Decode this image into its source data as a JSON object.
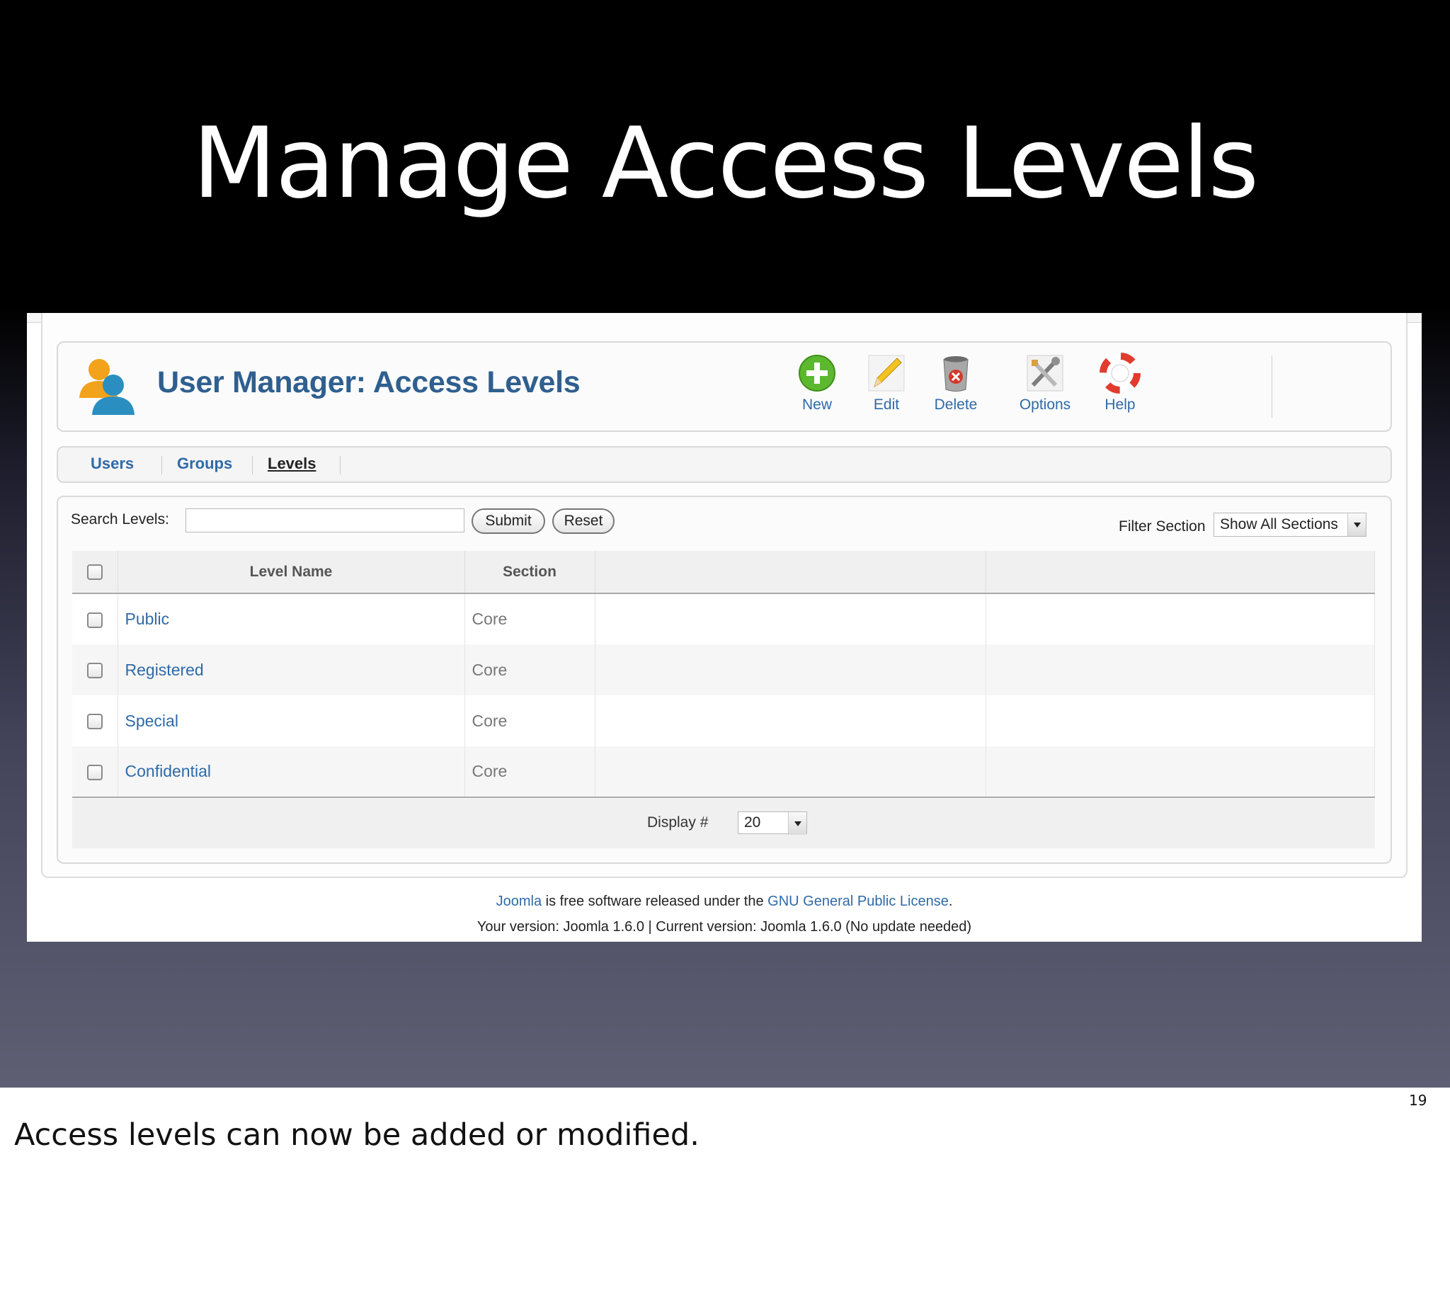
{
  "slide": {
    "title": "Manage Access Levels",
    "number": "19",
    "note": "Access levels can now be added or modified."
  },
  "header": {
    "title": "User Manager: Access Levels"
  },
  "toolbar": {
    "new_label": "New",
    "edit_label": "Edit",
    "delete_label": "Delete",
    "options_label": "Options",
    "help_label": "Help"
  },
  "submenu": {
    "tabs": [
      {
        "label": "Users",
        "active": false
      },
      {
        "label": "Groups",
        "active": false
      },
      {
        "label": "Levels",
        "active": true
      }
    ]
  },
  "filters": {
    "search_label": "Search Levels:",
    "search_value": "",
    "submit_label": "Submit",
    "reset_label": "Reset",
    "filter_label": "Filter Section",
    "filter_selected": "Show All Sections"
  },
  "table": {
    "columns": [
      "Level Name",
      "Section"
    ],
    "rows": [
      {
        "name": "Public",
        "section": "Core"
      },
      {
        "name": "Registered",
        "section": "Core"
      },
      {
        "name": "Special",
        "section": "Core"
      },
      {
        "name": "Confidential",
        "section": "Core"
      }
    ]
  },
  "pagination": {
    "display_label": "Display #",
    "display_value": "20"
  },
  "footer": {
    "joomla_link": "Joomla",
    "free_text": " is free software released under the ",
    "license_link": "GNU General Public License",
    "license_end": ".",
    "version_text": "Your version: Joomla 1.6.0 | Current version: Joomla 1.6.0 (No update needed)"
  },
  "colors": {
    "title_blue": "#2f5f8e",
    "link_blue": "#2f6aa8",
    "new_green": "#5cb82e",
    "delete_red": "#d33a2c",
    "help_red": "#e23b2e"
  }
}
